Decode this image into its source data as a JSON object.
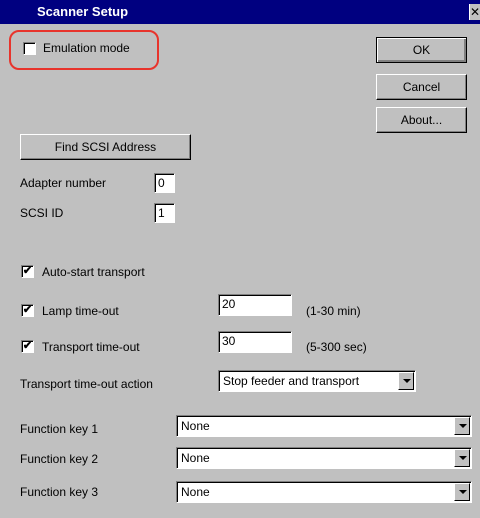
{
  "window": {
    "title": "Scanner Setup",
    "close_glyph": "✕"
  },
  "emulation": {
    "label": "Emulation mode",
    "checked": false,
    "highlight_color": "#e8342c"
  },
  "buttons": {
    "ok": "OK",
    "cancel": "Cancel",
    "about": "About...",
    "find_scsi": "Find SCSI Address"
  },
  "adapter": {
    "label": "Adapter number",
    "value": "0"
  },
  "scsi_id": {
    "label": "SCSI ID",
    "value": "1"
  },
  "auto_start": {
    "label": "Auto-start transport",
    "checked": true
  },
  "lamp": {
    "label": "Lamp time-out",
    "checked": true,
    "value": "20",
    "range": "(1-30 min)"
  },
  "transport": {
    "label": "Transport time-out",
    "checked": true,
    "value": "30",
    "range": "(5-300 sec)"
  },
  "timeout_action": {
    "label": "Transport time-out action",
    "value": "Stop feeder and transport"
  },
  "function_keys": [
    {
      "label": "Function key 1",
      "value": "None"
    },
    {
      "label": "Function key 2",
      "value": "None"
    },
    {
      "label": "Function key 3",
      "value": "None"
    }
  ],
  "colors": {
    "titlebar": "#000080",
    "dialog": "#c0c0c0"
  }
}
